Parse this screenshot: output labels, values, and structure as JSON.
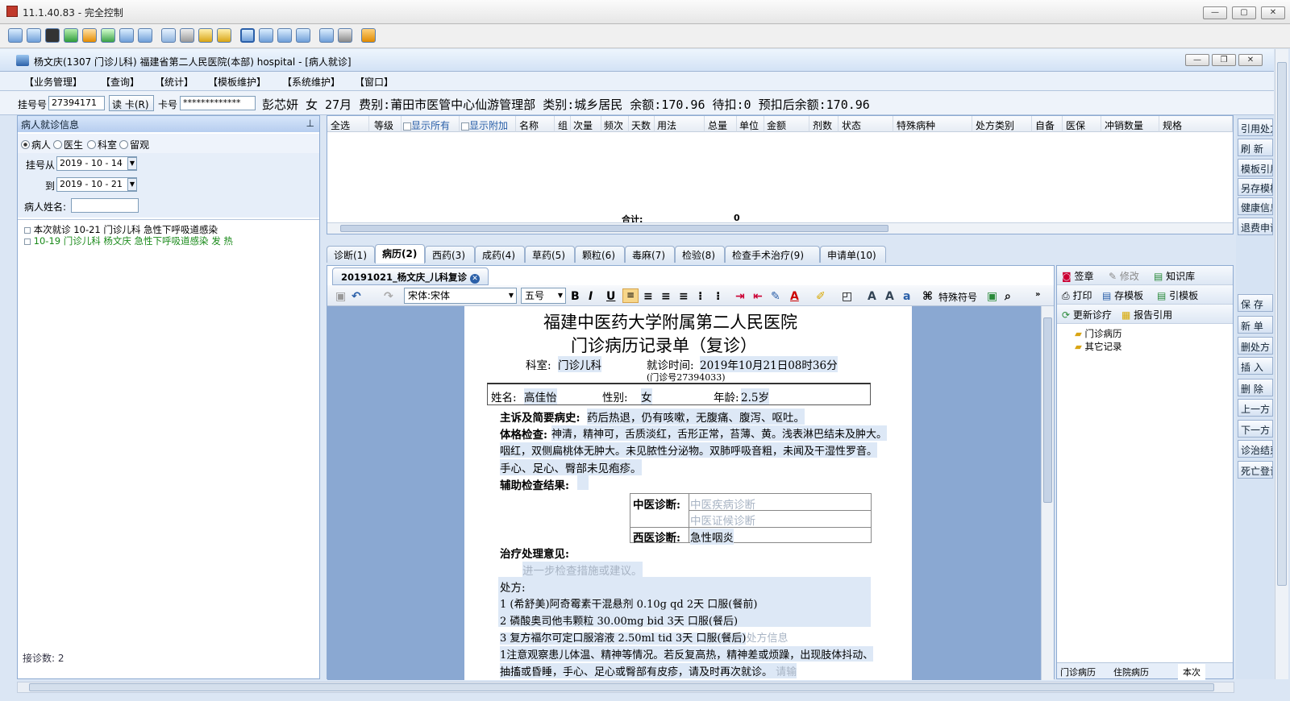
{
  "window": {
    "title": "11.1.40.83 - 完全控制"
  },
  "app": {
    "title": "杨文庆(1307 门诊儿科) 福建省第二人民医院(本部) hospital - [病人就诊]",
    "menus": [
      "【业务管理】",
      "【查询】",
      "【统计】",
      "【模板维护】",
      "【系统维护】",
      "【窗口】"
    ]
  },
  "infobar": {
    "reg_label": "挂号号",
    "reg_value": "27394171",
    "read_card": "读 卡(R)",
    "card_label": "卡号",
    "card_value": "*************",
    "patient_info": "彭芯妍  女  27月  费别:莆田市医管中心仙游管理部  类别:城乡居民  余额:170.96  待扣:0  预扣后余额:170.96"
  },
  "left_panel": {
    "title": "病人就诊信息",
    "pin": "ᵖ",
    "radios": [
      {
        "label": "病人",
        "checked": true
      },
      {
        "label": "医生",
        "checked": false
      },
      {
        "label": "科室",
        "checked": false
      },
      {
        "label": "留观",
        "checked": false
      }
    ],
    "from_label": "挂号从",
    "from_date": "2019 - 10 - 14",
    "to_label": "到",
    "to_date": "2019 - 10 - 21",
    "name_label": "病人姓名:",
    "tree": [
      {
        "text": "本次就诊  10-21  门诊儿科  急性下呼吸道感染",
        "color": "#000000"
      },
      {
        "text": "10-19  门诊儿科  杨文庆  急性下呼吸道感染 发 热",
        "color": "#1a8a1a"
      }
    ],
    "footer": "接诊数: 2"
  },
  "grid": {
    "columns": [
      "全选",
      "等级",
      "显示所有",
      "显示附加",
      "名称",
      "组",
      "次量",
      "频次",
      "天数",
      "用法",
      "总量",
      "单位",
      "金额",
      "剂数",
      "状态",
      "特殊病种",
      "处方类别",
      "自备",
      "医保",
      "冲销数量",
      "规格"
    ],
    "total_label": "合计:",
    "total_value": "0"
  },
  "tabs": [
    "诊断(1)",
    "病历(2)",
    "西药(3)",
    "成药(4)",
    "草药(5)",
    "颗粒(6)",
    "毒麻(7)",
    "检验(8)",
    "检查手术治疗(9)",
    "申请单(10)"
  ],
  "active_tab": "病历(2)",
  "doc_tab": "20191021_杨文庆_儿科复诊",
  "toolbar": {
    "font_name": "宋体:宋体",
    "font_size": "五号",
    "special": "特殊符号"
  },
  "paper": {
    "hospital": "福建中医药大学附属第二人民医院",
    "title": "门诊病历记录单（复诊）",
    "dept_label": "科室:",
    "dept": "门诊儿科",
    "visit_label": "就诊时间:",
    "visit_time": "2019年10月21日08时36分",
    "clinic_no": "(门诊号27394033)",
    "name_label": "姓名:",
    "name": "高佳怡",
    "gender_label": "性别:",
    "gender": "女",
    "age_label": "年龄:",
    "age": "2.5岁",
    "complaint_label": "主诉及简要病史:",
    "complaint": "药后热退，仍有咳嗽，无腹痛、腹泻、呕吐。",
    "exam_label": "体格检查:",
    "exam1": "神清，精神可，舌质淡红，舌形正常，苔薄、黄。浅表淋巴结未及肿大。",
    "exam2": "咽红，双侧扁桃体无肿大。未见脓性分泌物。双肺呼吸音粗，未闻及干湿性罗音。",
    "exam3": "手心、足心、臀部未见疱疹。",
    "aux_label": "辅助检查结果:",
    "tcm_label": "中医诊断:",
    "tcm_disease": "中医疾病诊断",
    "tcm_syndrome": "中医证候诊断",
    "wm_label": "西医诊断:",
    "wm_diag": "急性咽炎",
    "treat_label": "治疗处理意见:",
    "treat_hint": "进一步检查措施或建议。",
    "rx_label": "处方:",
    "rx1": "1  (希舒美)阿奇霉素干混悬剂  0.10g  qd  2天  口服(餐前)",
    "rx2": "2  磷酸奥司他韦颗粒  30.00mg  bid  3天  口服(餐后)",
    "rx3": "3  复方福尔可定口服溶液  2.50ml  tid  3天  口服(餐后)",
    "rx_hint": "处方信息",
    "advice1": "1注意观察患儿体温、精神等情况。若反复高热，精神差或烦躁，出现肢体抖动、",
    "advice2": "抽搐或昏睡，手心、足心或臀部有皮疹，请及时再次就诊。",
    "advice_hint": "请输"
  },
  "right_panel": {
    "row1": [
      "签章",
      "修改",
      "知识库"
    ],
    "row2": [
      "打印",
      "存模板",
      "引模板"
    ],
    "row3": [
      "更新诊疗",
      "报告引用"
    ],
    "tree": [
      "门诊病历",
      "其它记录"
    ],
    "bottom_tabs": [
      "门诊病历",
      "住院病历",
      "本次"
    ]
  },
  "side_buttons": [
    "引用处方",
    "刷 新",
    "模板引用",
    "另存模板",
    "健康信息",
    "退费申请",
    "保 存",
    "新 单",
    "删处方",
    "插 入",
    "删 除",
    "上一方",
    "下一方",
    "诊治结束",
    "死亡登记"
  ],
  "colors": {
    "accent": "#2a5fa8",
    "green": "#1a8a1a",
    "page_bg": "#8aa8d2"
  }
}
